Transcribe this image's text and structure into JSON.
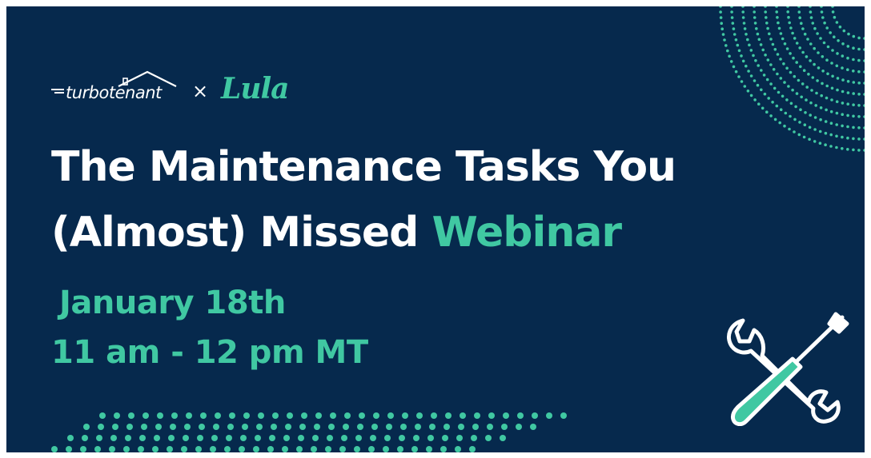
{
  "logos": {
    "turbotenant": "turbotenant",
    "separator": "×",
    "lula": "Lula"
  },
  "title": {
    "line1": "The Maintenance Tasks You",
    "line2": "(Almost) Missed",
    "accent": "Webinar"
  },
  "event": {
    "date": "January 18th",
    "time": "11 am - 12 pm MT"
  },
  "icons": {
    "tools": "wrench-screwdriver-icon",
    "roof": "house-roof-icon"
  },
  "colors": {
    "background": "#06294d",
    "accent": "#40c8a2",
    "text": "#ffffff"
  }
}
